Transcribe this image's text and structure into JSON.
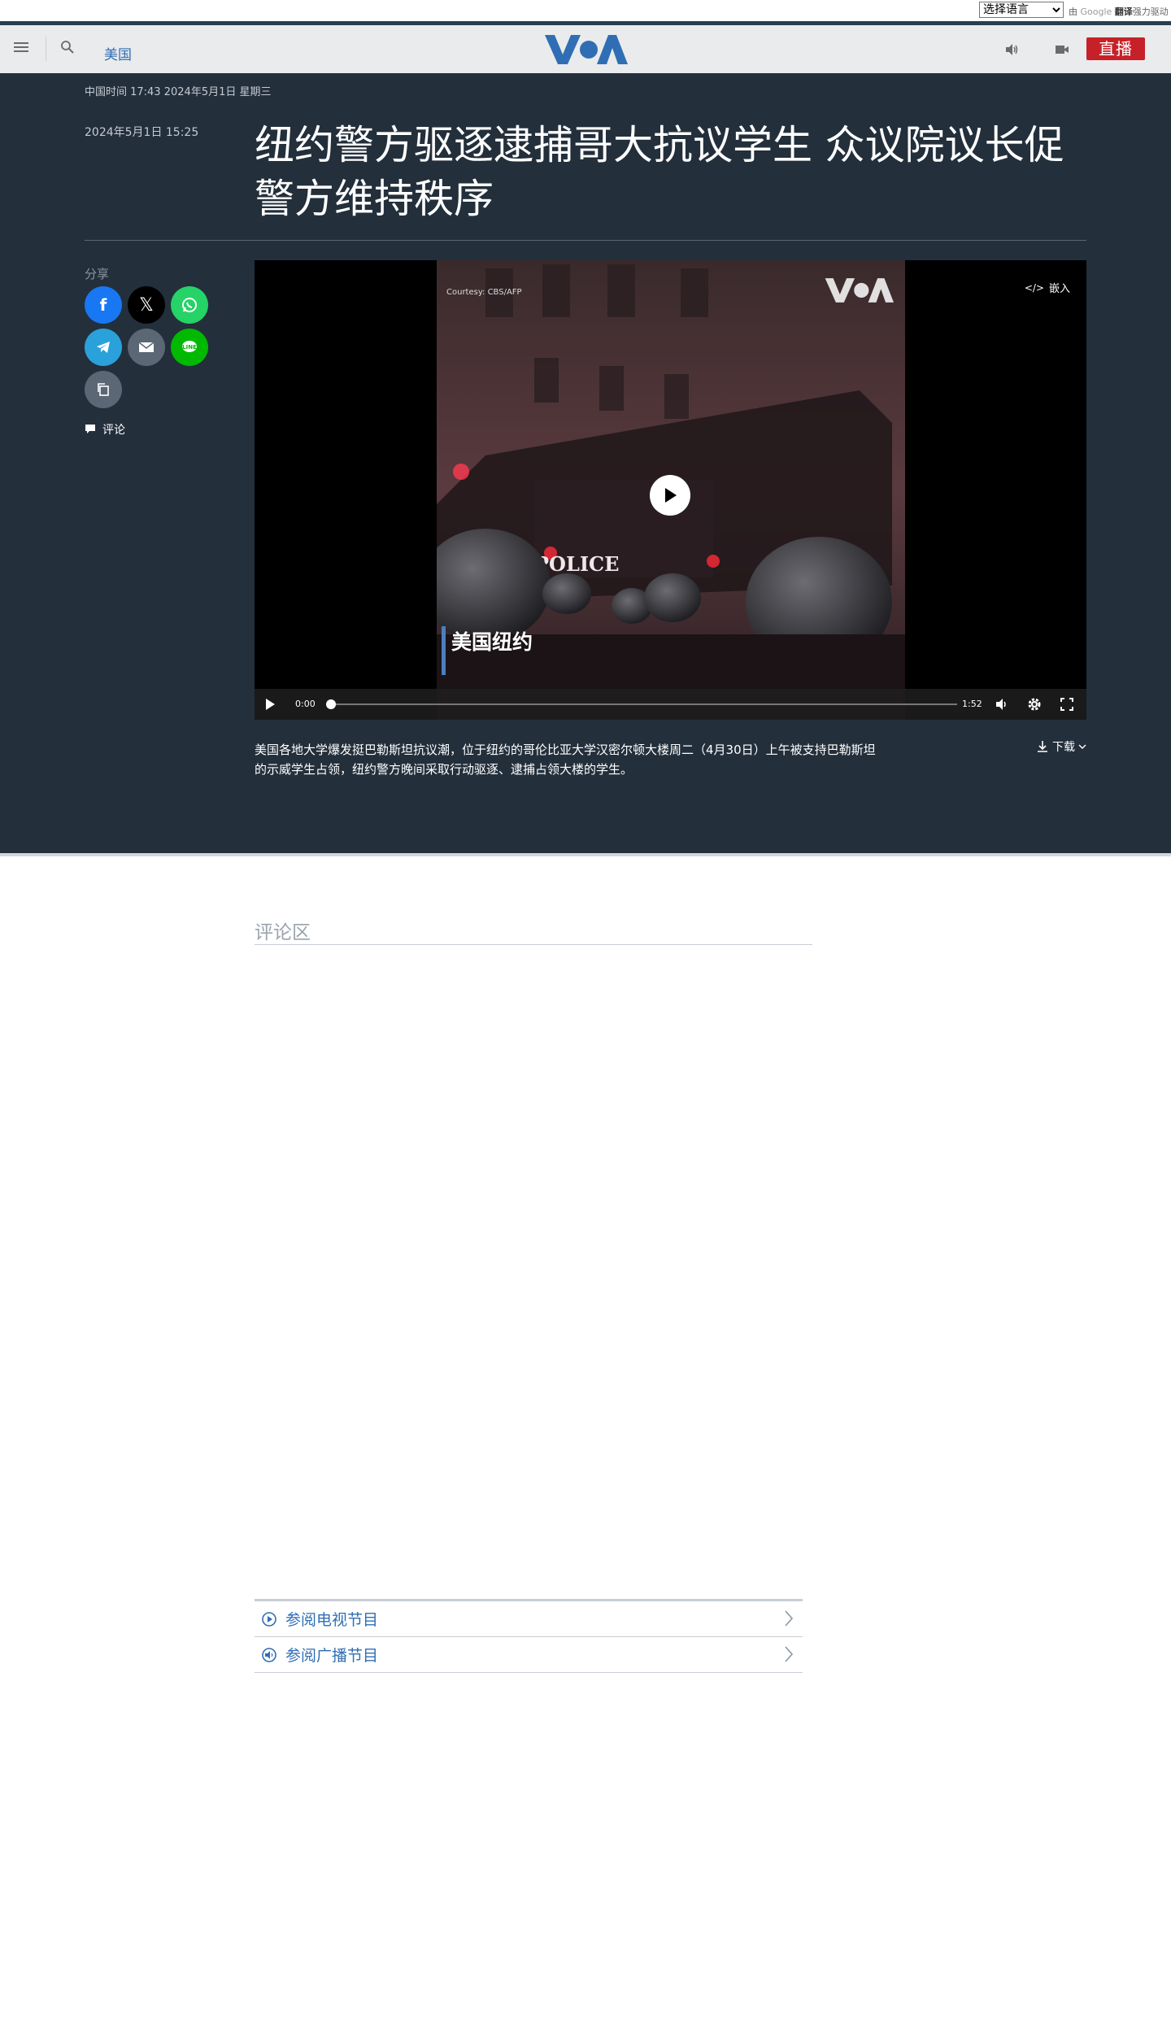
{
  "translate": {
    "selected": "选择语言",
    "credit_prefix": "由",
    "credit_google": "Google",
    "credit_translate": "翻译",
    "credit_suffix": "强力驱动"
  },
  "header": {
    "section_link": "美国",
    "live_label": "直播",
    "brand_color": "#2f6eb5",
    "live_color": "#c62128"
  },
  "article": {
    "china_time": "中国时间 17:43 2024年5月1日 星期三",
    "published": "2024年5月1日 15:25",
    "headline": "纽约警方驱逐逮捕哥大抗议学生 众议院议长促警方维持秩序"
  },
  "share": {
    "label": "分享",
    "buttons": [
      "facebook-icon",
      "x-icon",
      "whatsapp-icon",
      "telegram-icon",
      "email-icon",
      "line-icon",
      "copy-link-icon"
    ],
    "comment_label": "评论"
  },
  "video": {
    "embed_label": "嵌入",
    "courtesy": "Courtesy: CBS/AFP",
    "overlay_text": "美国纽约",
    "police_text": "POLICE",
    "current_time": "0:00",
    "duration": "1:52",
    "progress": 0,
    "caption": "美国各地大学爆发挺巴勒斯坦抗议潮，位于纽约的哥伦比亚大学汉密尔顿大楼周二（4月30日）上午被支持巴勒斯坦的示威学生占领，纽约警方晚间采取行动驱逐、逮捕占领大楼的学生。",
    "download_label": "下载"
  },
  "comments": {
    "title": "评论区"
  },
  "programs": {
    "items": [
      {
        "label": "参阅电视节目",
        "icon": "play-circle-icon"
      },
      {
        "label": "参阅广播节目",
        "icon": "speaker-circle-icon"
      }
    ]
  }
}
